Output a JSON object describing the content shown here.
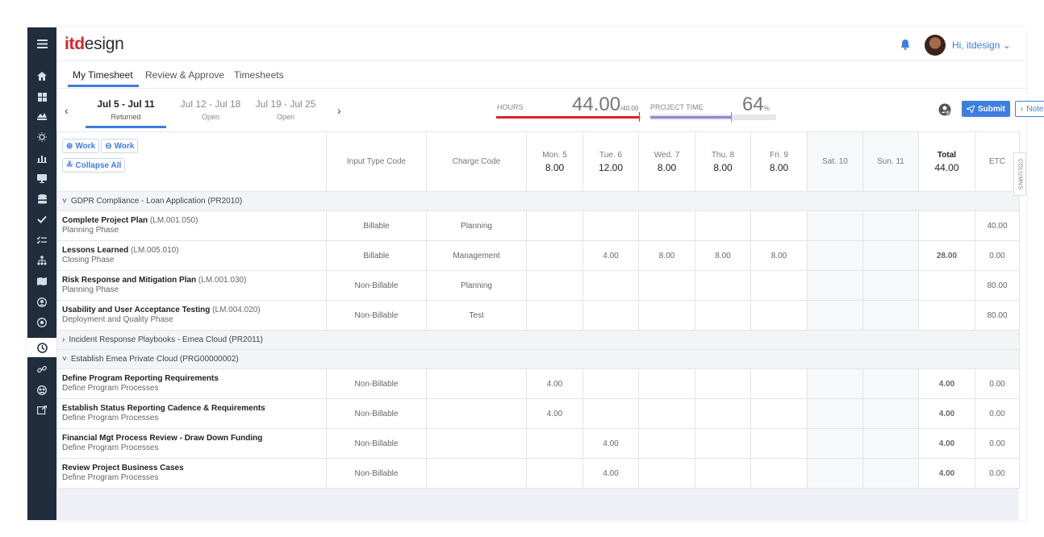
{
  "app": {
    "logo_a": "itd",
    "logo_b": "esign",
    "greeting": "Hi, itdesign ⌄"
  },
  "tabs": [
    {
      "label": "My Timesheet",
      "active": true
    },
    {
      "label": "Review & Approve"
    },
    {
      "label": "Timesheets"
    }
  ],
  "weeks": [
    {
      "range": "Jul 5 - Jul 11",
      "status": "Returned",
      "active": true
    },
    {
      "range": "Jul 12 - Jul 18",
      "status": "Open"
    },
    {
      "range": "Jul 19 - Jul 25",
      "status": "Open"
    }
  ],
  "nav": {
    "prev": "‹",
    "next": "›"
  },
  "hours": {
    "label": "HOURS",
    "value": "44.00",
    "max": "/40.00",
    "fraction": 1.1,
    "color": "#d9232d"
  },
  "project_time": {
    "label": "PROJECT TIME",
    "value": "64",
    "unit": "%",
    "fraction": 0.64,
    "color": "#9b7fd6"
  },
  "buttons": {
    "submit": "Submit",
    "notes": "Notes"
  },
  "grid": {
    "add_work": "Work",
    "remove_work": "Work",
    "collapse": "Collapse All",
    "columns_tab": "COLUMNS",
    "headers": {
      "input_type": "Input Type Code",
      "charge": "Charge Code",
      "mon": "Mon. 5",
      "mon_v": "8.00",
      "tue": "Tue. 6",
      "tue_v": "12.00",
      "wed": "Wed. 7",
      "wed_v": "8.00",
      "thu": "Thu. 8",
      "thu_v": "8.00",
      "fri": "Fri. 9",
      "fri_v": "8.00",
      "sat": "Sat. 10",
      "sun": "Sun. 11",
      "total": "Total",
      "total_v": "44.00",
      "etc": "ETC"
    },
    "groups": [
      {
        "chevron": "˅",
        "title": "GDPR Compliance - Loan Application (PR2010)",
        "rows": [
          {
            "name": "Complete Project Plan",
            "code": "(LM.001.050)",
            "phase": "Planning Phase",
            "input": "Billable",
            "charge": "Planning",
            "mon": "",
            "tue": "",
            "wed": "",
            "thu": "",
            "fri": "",
            "sat": "",
            "sun": "",
            "total": "",
            "etc": "40.00"
          },
          {
            "name": "Lessons Learned",
            "code": "(LM.005.010)",
            "phase": "Closing Phase",
            "input": "Billable",
            "charge": "Management",
            "mon": "",
            "tue": "4.00",
            "wed": "8.00",
            "thu": "8.00",
            "fri": "8.00",
            "sat": "",
            "sun": "",
            "total": "28.00",
            "etc": "0.00"
          },
          {
            "name": "Risk Response and Mitigation Plan",
            "code": "(LM.001.030)",
            "phase": "Planning Phase",
            "input": "Non-Billable",
            "charge": "Planning",
            "mon": "",
            "tue": "",
            "wed": "",
            "thu": "",
            "fri": "",
            "sat": "",
            "sun": "",
            "total": "",
            "etc": "80.00"
          },
          {
            "name": "Usability and User Acceptance Testing",
            "code": "(LM.004.020)",
            "phase": "Deployment and Quality Phase",
            "input": "Non-Billable",
            "charge": "Test",
            "mon": "",
            "tue": "",
            "wed": "",
            "thu": "",
            "fri": "",
            "sat": "",
            "sun": "",
            "total": "",
            "etc": "80.00"
          }
        ]
      },
      {
        "chevron": "›",
        "title": "Incident Response Playbooks - Emea Cloud (PR2011)",
        "rows": []
      },
      {
        "chevron": "˅",
        "title": "Establish Emea Private Cloud (PRG00000002)",
        "rows": [
          {
            "name": "Define Program Reporting Requirements",
            "code": "",
            "phase": "Define Program Processes",
            "input": "Non-Billable",
            "charge": "",
            "mon": "4.00",
            "tue": "",
            "wed": "",
            "thu": "",
            "fri": "",
            "sat": "",
            "sun": "",
            "total": "4.00",
            "etc": "0.00"
          },
          {
            "name": "Establish Status Reporting Cadence & Requirements",
            "code": "",
            "phase": "Define Program Processes",
            "input": "Non-Billable",
            "charge": "",
            "mon": "4.00",
            "tue": "",
            "wed": "",
            "thu": "",
            "fri": "",
            "sat": "",
            "sun": "",
            "total": "4.00",
            "etc": "0.00"
          },
          {
            "name": "Financial Mgt Process Review - Draw Down Funding",
            "code": "",
            "phase": "Define Program Processes",
            "input": "Non-Billable",
            "charge": "",
            "mon": "",
            "tue": "4.00",
            "wed": "",
            "thu": "",
            "fri": "",
            "sat": "",
            "sun": "",
            "total": "4.00",
            "etc": "0.00"
          },
          {
            "name": "Review Project Business Cases",
            "code": "",
            "phase": "Define Program Processes",
            "input": "Non-Billable",
            "charge": "",
            "mon": "",
            "tue": "4.00",
            "wed": "",
            "thu": "",
            "fri": "",
            "sat": "",
            "sun": "",
            "total": "4.00",
            "etc": "0.00"
          }
        ]
      }
    ]
  },
  "rail_icons": [
    "menu-icon",
    "home-icon",
    "dashboard-icon",
    "chart-mountain-icon",
    "lightbulb-icon",
    "bar-chart-icon",
    "monitor-icon",
    "database-icon",
    "check-icon",
    "checklist-icon",
    "org-chart-icon",
    "map-icon",
    "support-agent-icon",
    "settings-person-icon",
    "clock-icon",
    "link-icon",
    "group-settings-icon",
    "external-link-icon"
  ]
}
